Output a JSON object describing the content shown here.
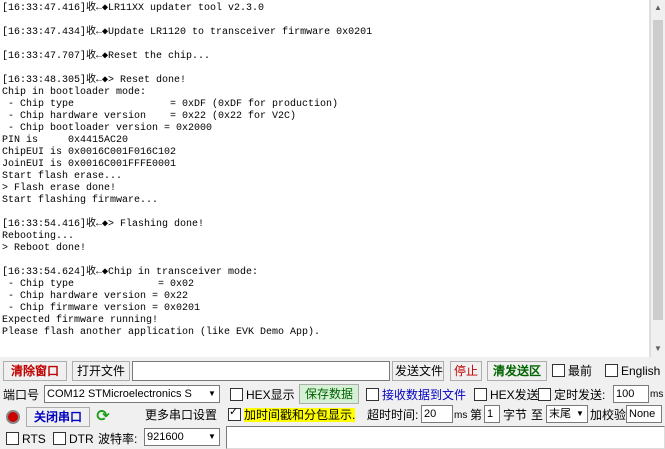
{
  "log": {
    "lines": [
      "[16:33:47.416]收←◆LR11XX updater tool v2.3.0",
      "",
      "[16:33:47.434]收←◆Update LR1120 to transceiver firmware 0x0201",
      "",
      "[16:33:47.707]收←◆Reset the chip...",
      "",
      "[16:33:48.305]收←◆> Reset done!",
      "Chip in bootloader mode:",
      " - Chip type                = 0xDF (0xDF for production)",
      " - Chip hardware version    = 0x22 (0x22 for V2C)",
      " - Chip bootloader version = 0x2000",
      "PIN is     0x4415AC20",
      "ChipEUI is 0x0016C001F016C102",
      "JoinEUI is 0x0016C001FFFE0001",
      "Start flash erase...",
      "> Flash erase done!",
      "Start flashing firmware...",
      "",
      "[16:33:54.416]收←◆> Flashing done!",
      "Rebooting...",
      "> Reboot done!",
      "",
      "[16:33:54.624]收←◆Chip in transceiver mode:",
      " - Chip type              = 0x02",
      " - Chip hardware version = 0x22",
      " - Chip firmware version = 0x0201",
      "Expected firmware running!",
      "Please flash another application (like EVK Demo App)."
    ]
  },
  "toolbar1": {
    "clear_window": "清除窗口",
    "open_file": "打开文件",
    "file_path": "",
    "send_file": "发送文件",
    "stop": "停止",
    "clear_send": "清发送区",
    "topmost": "最前",
    "english": "English"
  },
  "row2": {
    "port_label": "端口号",
    "port_value": "COM12 STMicroelectronics S",
    "hex_display": "HEX显示",
    "save_data": "保存数据",
    "recv_to_file": "接收数据到文件",
    "hex_send": "HEX发送",
    "timed_send": "定时发送:",
    "timed_value": "100",
    "timed_unit": "ms"
  },
  "row3": {
    "close_port": "关闭串口",
    "more_settings": "更多串口设置",
    "add_timestamp": "加时间戳和分包显示.",
    "timeout_label": "超时时间:",
    "timeout_value": "20",
    "timeout_unit": "ms",
    "nth_label": "第",
    "nth_value": "1",
    "byte_label": "字节",
    "to_label": "至",
    "to_value": "末尾",
    "checksum_label": "加校验",
    "checksum_value": "None"
  },
  "row4": {
    "rts": "RTS",
    "dtr": "DTR",
    "baud_label": "波特率:",
    "baud_value": "921600"
  },
  "colors": {
    "port_indicator": "#cc0000",
    "refresh_icon": "#1a9e1a",
    "timestamp_highlight": "#ffff00",
    "save_button_bg": "#d6f0d6"
  }
}
